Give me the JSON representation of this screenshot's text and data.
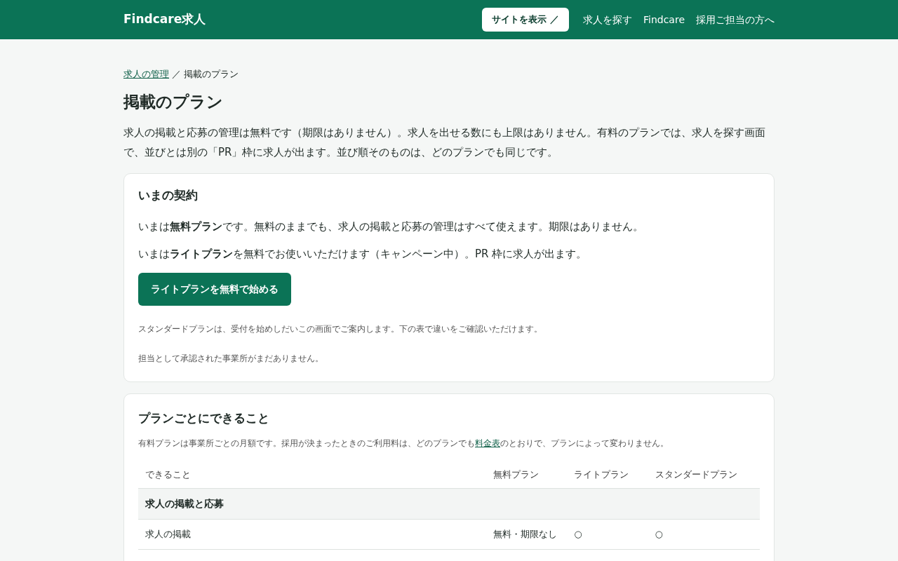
{
  "navbar": {
    "brand": "Findcare求人",
    "site_button": "サイトを表示 ／",
    "links": [
      "求人を探す",
      "Findcare",
      "採用ご担当の方へ"
    ]
  },
  "breadcrumb": {
    "link": "求人の管理",
    "separator": "／",
    "current": "掲載のプラン"
  },
  "title": "掲載のプラン",
  "intro": "求人の掲載と応募の管理は無料です（期限はありません）。求人を出せる数にも上限はありません。有料のプランでは、求人を探す画面で、並びとは別の「PR」枠に求人が出ます。並び順そのものは、どのプランでも同じです。",
  "current_contract": {
    "heading": "いまの契約",
    "lines": [
      "いまは**無料プラン**です。無料のままでも、求人の掲載と応募の管理はすべて使えます。期限はありません。",
      "いまは**ライトプラン**を無料でお使いいただけます（キャンペーン中）。PR 枠に求人が出ます。"
    ],
    "button": "ライトプランを無料で始める",
    "notes": [
      "スタンダードプランは、受付を始めしだいこの画面でご案内します。下の表で違いをご確認いただけます。",
      "担当として承認された事業所がまだありません。"
    ]
  },
  "plans": {
    "heading": "プランごとにできること",
    "note_before": "有料プランは事業所ごとの月額です。採用が決まったときのご利用料は、どのプランでも",
    "note_link": "料金表",
    "note_after": "のとおりで、プランによって変わりません。",
    "table": {
      "columns": [
        "できること",
        "無料プラン",
        "ライトプラン",
        "スタンダードプラン"
      ],
      "rows": [
        {
          "kind": "section",
          "label": "求人の掲載と応募"
        },
        {
          "kind": "feature",
          "cells": [
            "求人の掲載",
            "無料・期限なし",
            "○",
            "○"
          ]
        }
      ]
    }
  }
}
